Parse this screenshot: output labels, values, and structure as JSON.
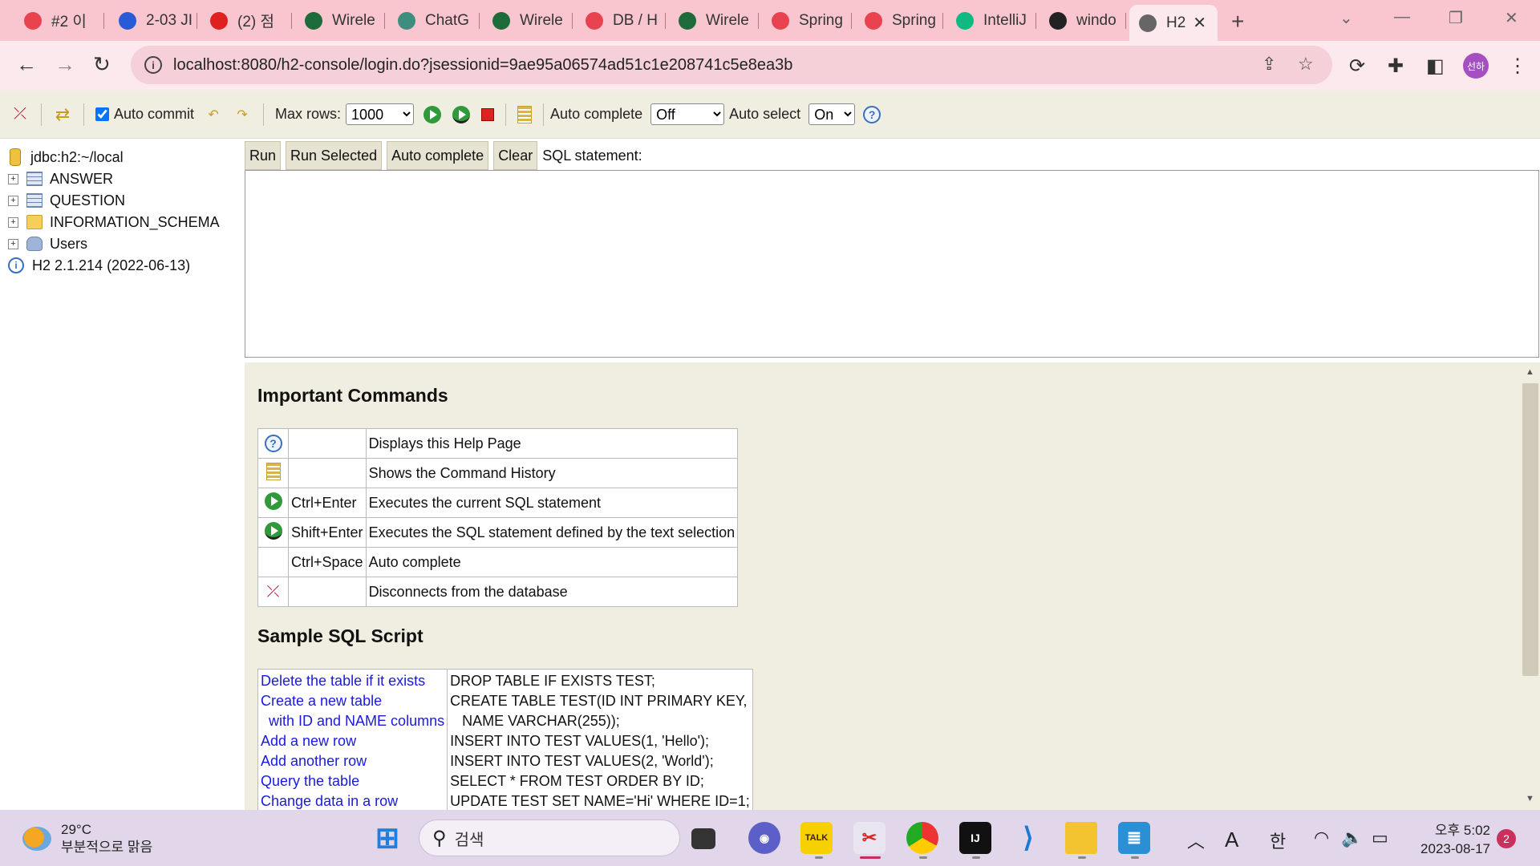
{
  "browser": {
    "tabs": [
      {
        "label": "#2 이",
        "icon_color": "#e8434f"
      },
      {
        "label": "2-03 JI",
        "icon_color": "#2a5bd7"
      },
      {
        "label": "(2) 점",
        "icon_color": "#e02020"
      },
      {
        "label": "Wirele",
        "icon_color": "#1e6b3a"
      },
      {
        "label": "ChatG",
        "icon_color": "#3e8e7e"
      },
      {
        "label": "Wirele",
        "icon_color": "#1e6b3a"
      },
      {
        "label": "DB / H",
        "icon_color": "#e8434f"
      },
      {
        "label": "Wirele",
        "icon_color": "#1e6b3a"
      },
      {
        "label": "Spring",
        "icon_color": "#e8434f"
      },
      {
        "label": "Spring",
        "icon_color": "#e8434f"
      },
      {
        "label": "IntelliJ",
        "icon_color": "#10b981"
      },
      {
        "label": "windo",
        "icon_color": "#222222"
      },
      {
        "label": "H2",
        "icon_color": "#666666"
      }
    ],
    "url": "localhost:8080/h2-console/login.do?jsessionid=9ae95a06574ad51c1e208741c5e8ea3b",
    "profile_initials": "선하"
  },
  "toolbar": {
    "auto_commit_label": "Auto commit",
    "auto_commit_checked": true,
    "max_rows_label": "Max rows:",
    "max_rows_value": "1000",
    "auto_complete_label": "Auto complete",
    "auto_complete_value": "Off",
    "auto_select_label": "Auto select",
    "auto_select_value": "On"
  },
  "tree": {
    "connection": "jdbc:h2:~/local",
    "items": [
      {
        "label": "ANSWER",
        "icon": "table-icon"
      },
      {
        "label": "QUESTION",
        "icon": "table-icon"
      },
      {
        "label": "INFORMATION_SCHEMA",
        "icon": "folder-icon"
      },
      {
        "label": "Users",
        "icon": "users-icon"
      }
    ],
    "version": "H2 2.1.214 (2022-06-13)"
  },
  "query": {
    "run": "Run",
    "run_selected": "Run Selected",
    "auto_complete": "Auto complete",
    "clear": "Clear",
    "sql_label": "SQL statement:",
    "sql_text": ""
  },
  "help": {
    "commands_title": "Important Commands",
    "commands": [
      {
        "icon": "help-icon",
        "key": "",
        "desc": "Displays this Help Page"
      },
      {
        "icon": "history-icon",
        "key": "",
        "desc": "Shows the Command History"
      },
      {
        "icon": "run-icon",
        "key": "Ctrl+Enter",
        "desc": "Executes the current SQL statement"
      },
      {
        "icon": "run-selected-icon",
        "key": "Shift+Enter",
        "desc": "Executes the SQL statement defined by the text selection"
      },
      {
        "icon": "",
        "key": "Ctrl+Space",
        "desc": "Auto complete"
      },
      {
        "icon": "disconnect-icon",
        "key": "",
        "desc": "Disconnects from the database"
      }
    ],
    "sample_title": "Sample SQL Script",
    "sample_links": [
      "Delete the table if it exists",
      "Create a new table",
      "  with ID and NAME columns",
      "Add a new row",
      "Add another row",
      "Query the table",
      "Change data in a row"
    ],
    "sample_sql": [
      "DROP TABLE IF EXISTS TEST;",
      "CREATE TABLE TEST(ID INT PRIMARY KEY,",
      "   NAME VARCHAR(255));",
      "INSERT INTO TEST VALUES(1, 'Hello');",
      "INSERT INTO TEST VALUES(2, 'World');",
      "SELECT * FROM TEST ORDER BY ID;",
      "UPDATE TEST SET NAME='Hi' WHERE ID=1;"
    ]
  },
  "taskbar": {
    "temperature": "29°C",
    "weather": "부분적으로 맑음",
    "search_placeholder": "검색",
    "ime_letter": "A",
    "ime_lang": "한",
    "time": "오후 5:02",
    "date": "2023-08-17",
    "notifications": "2"
  }
}
